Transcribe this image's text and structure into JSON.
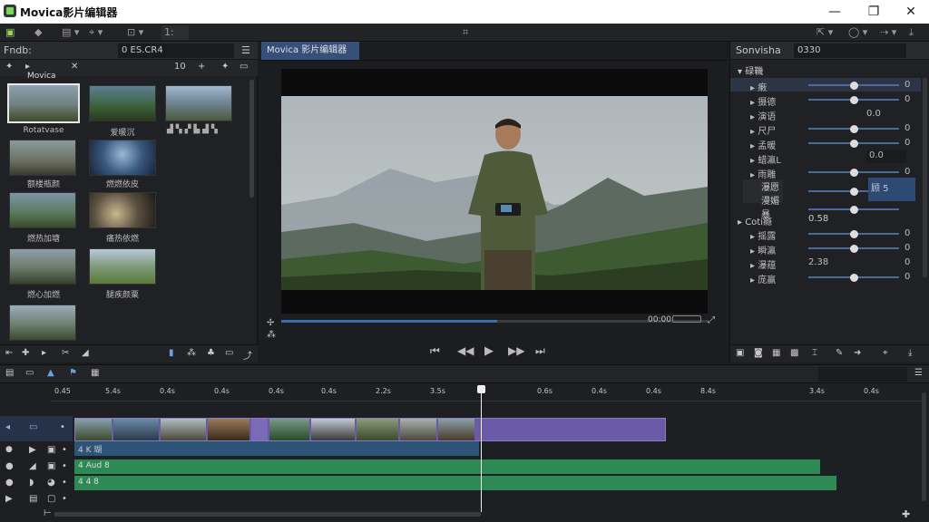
{
  "window": {
    "title": "Movica影片编辑器",
    "min": "—",
    "max": "❐",
    "close": "✕"
  },
  "toolbar": {
    "center_icon": "⌗",
    "value": "1:"
  },
  "media": {
    "header_title": "Fndb:",
    "search_value": "0 ES.CR4",
    "menu_icon": "☰",
    "folder_label": "Movica",
    "items": [
      {
        "label": "Rotatvase"
      },
      {
        "label": "爱暖沉"
      },
      {
        "label": ""
      },
      {
        "label": "额楼瓶颜"
      },
      {
        "label": "燃燃依皮"
      },
      {
        "label": "燃热加塘"
      },
      {
        "label": "痛热依燃"
      },
      {
        "label": "燃心加燃"
      },
      {
        "label": "腿疾颜粟"
      },
      {
        "label": ""
      }
    ]
  },
  "viewer": {
    "tab_label": "Movica 影片编辑器",
    "time_left": "",
    "time_right": "00:00",
    "buttons": [
      "⏮",
      "◀◀",
      "▶",
      "▶▶",
      "⏭"
    ]
  },
  "props": {
    "header_title": "Sonvisha",
    "header_value": "0330",
    "section1": "碌鞿",
    "rows": [
      {
        "label": "瘷",
        "value": "0"
      },
      {
        "label": "摄德",
        "value": "0"
      },
      {
        "label": "演语",
        "value": "0.0"
      },
      {
        "label": "尺尸",
        "value": "0"
      },
      {
        "label": "孟暖",
        "value": "0"
      },
      {
        "label": "蜡瀛L",
        "value": "0.0"
      },
      {
        "label": "雨雕",
        "value": "0"
      },
      {
        "label": "瀑愿",
        "value": ""
      },
      {
        "label": "漫媚暴",
        "value": ""
      }
    ],
    "side_box_value": "顾 5",
    "section2": "Coti瘾",
    "section2_value": "0.58",
    "rows2": [
      {
        "label": "摇露",
        "value": "0"
      },
      {
        "label": "瞬瀛",
        "value": "0"
      },
      {
        "label": "瀑蕴",
        "value": "2.38"
      },
      {
        "label": "庞赢",
        "value": "0"
      }
    ]
  },
  "timeline": {
    "ruler": [
      "0.45",
      "5.4s",
      "0.4s",
      "0.4s",
      "0.4s",
      "0.4s",
      "2.2s",
      "3.5s",
      "0.6s",
      "0.4s",
      "0.4s",
      "8.4s",
      "3.4s",
      "0.4s"
    ],
    "video_track_label": "",
    "audio1_label": "4 K 瑚",
    "audio2_label": "4 Aud 8",
    "audio3_label": "4 4 8"
  },
  "colors": {
    "accent": "#3d6aa8",
    "video_clip": "#6b5aa8",
    "audio": "#2e8a55"
  }
}
